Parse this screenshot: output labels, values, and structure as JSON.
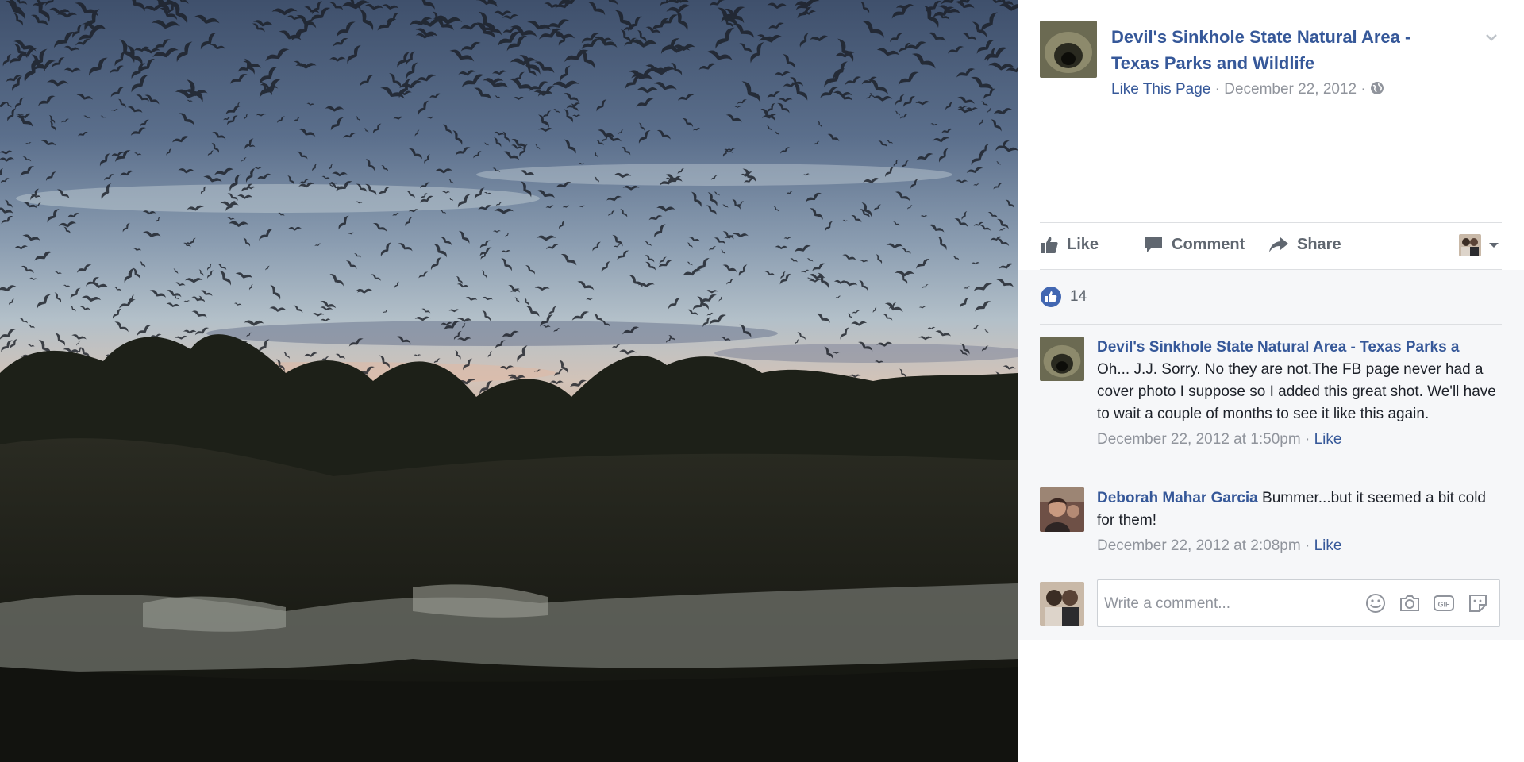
{
  "photo": {
    "icon": "bats-at-dusk-photo",
    "colors": {
      "sky_top": "#4c5f7d",
      "sky_mid": "#95a8ba",
      "horizon": "#d9b9a4",
      "trees": "#1f2218",
      "rocks": "#8a8c86"
    }
  },
  "post": {
    "page_name": "Devil's Sinkhole State Natural Area - Texas Parks and Wildlife",
    "like_page_label": "Like This Page",
    "separator": "·",
    "date": "December 22, 2012",
    "privacy_icon": "globe-icon",
    "menu_icon": "chevron-down-icon"
  },
  "actions": {
    "like_label": "Like",
    "comment_label": "Comment",
    "share_label": "Share",
    "viewer_icon": "chevron-down-icon"
  },
  "reactions": {
    "icon": "like-reaction-icon",
    "count": "14",
    "color": "#4267b2"
  },
  "comments": [
    {
      "author": "Devil's Sinkhole State Natural Area - Texas Parks a",
      "text": "Oh... J.J. Sorry. No they are not.The FB page never had a cover photo I suppose so I added this great shot. We'll have to wait a couple of months to see it like this again.",
      "time": "December 22, 2012 at 1:50pm",
      "separator": "·",
      "like_label": "Like"
    },
    {
      "author": "Deborah Mahar Garcia",
      "text": "Bummer...but it seemed a bit cold for them!",
      "time": "December 22, 2012 at 2:08pm",
      "separator": "·",
      "like_label": "Like"
    }
  ],
  "composer": {
    "placeholder": "Write a comment...",
    "tools": [
      "emoji-icon",
      "camera-icon",
      "gif-icon",
      "sticker-icon"
    ]
  },
  "colors": {
    "link": "#365899",
    "muted": "#90949c",
    "action": "#606770",
    "panel_gray": "#f6f7f9"
  }
}
